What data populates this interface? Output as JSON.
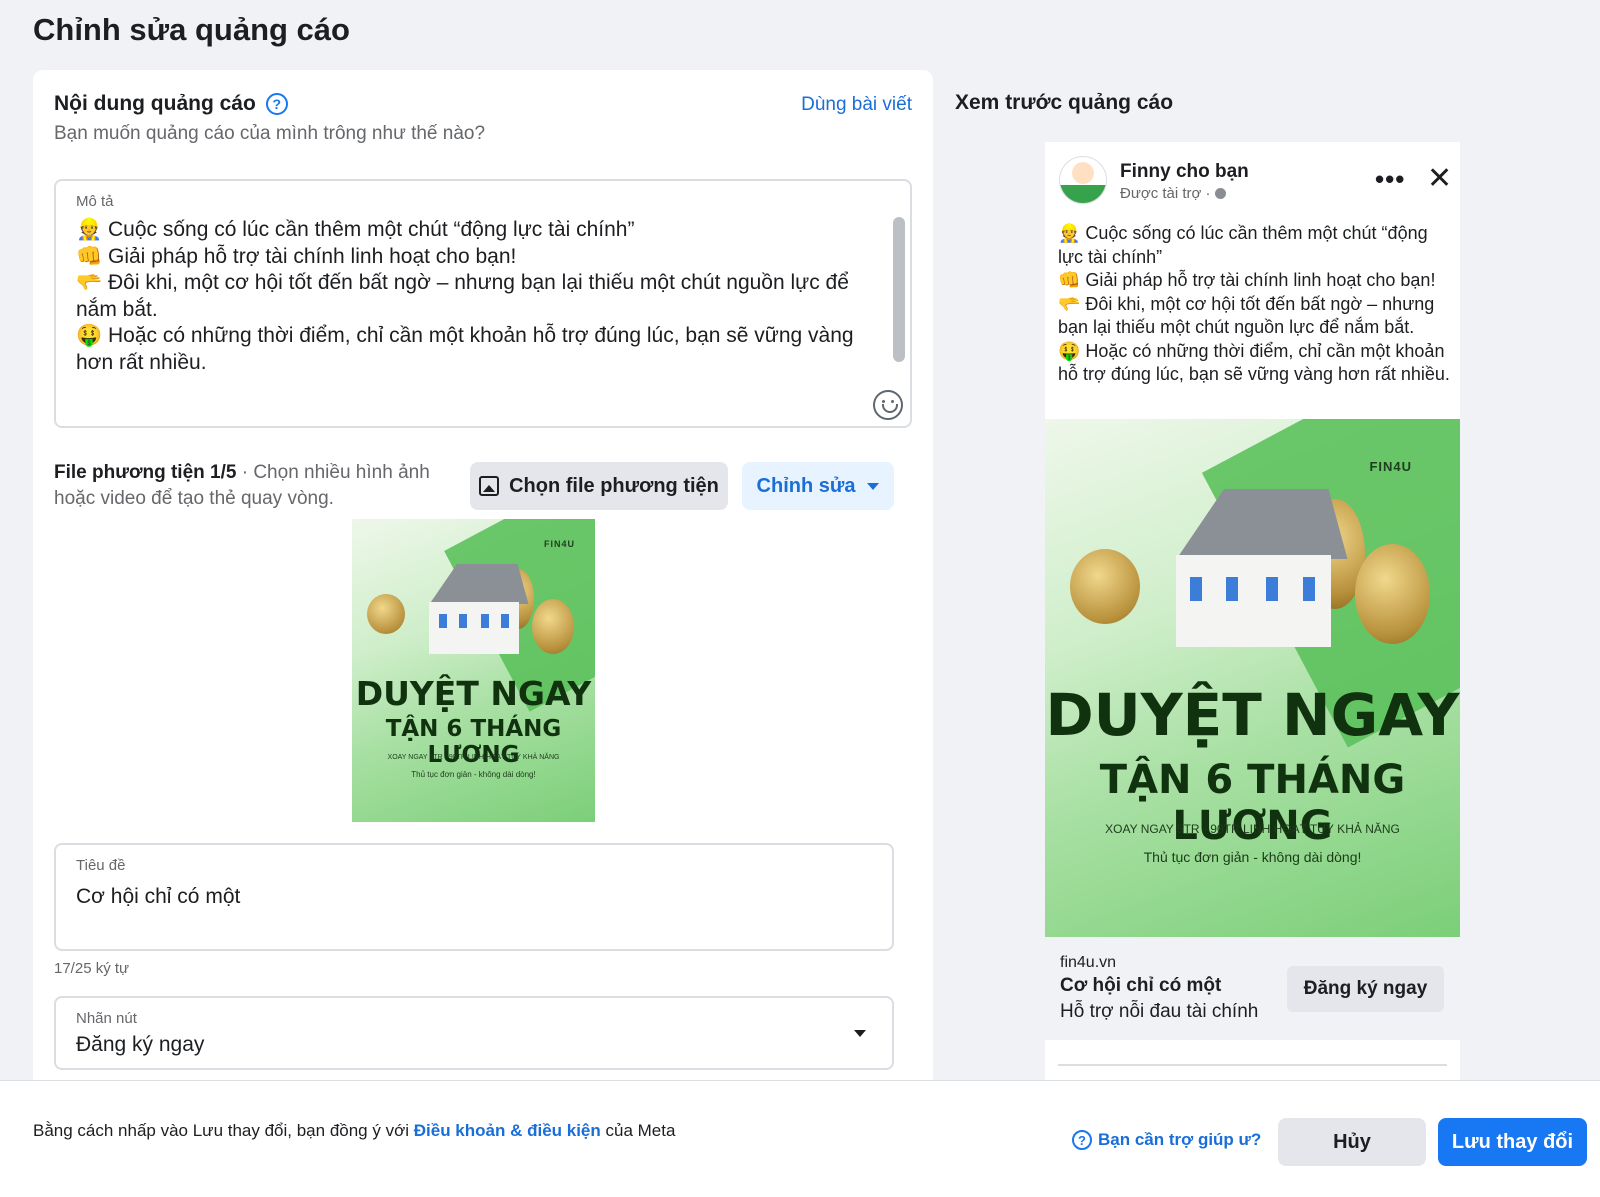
{
  "page": {
    "title": "Chỉnh sửa quảng cáo"
  },
  "content": {
    "section_title": "Nội dung quảng cáo",
    "use_post_link": "Dùng bài viết",
    "subtitle": "Bạn muốn quảng cáo của mình trông như thế nào?",
    "description_label": "Mô tả",
    "description_lines": [
      "👷 Cuộc sống có lúc cần thêm một chút “động lực tài chính”",
      "👊 Giải pháp hỗ trợ tài chính linh hoạt cho bạn!",
      "🫳 Đôi khi, một cơ hội tốt đến bất ngờ – nhưng bạn lại thiếu một chút nguồn lực để nắm bắt.",
      "🤑 Hoặc có những thời điểm, chỉ cần một khoản hỗ trợ đúng lúc, bạn sẽ vững vàng hơn rất nhiều."
    ],
    "media_title": "File phương tiện 1/5",
    "media_hint": "· Chọn nhiều hình ảnh hoặc video để tạo thẻ quay vòng.",
    "choose_media_button": "Chọn file phương tiện",
    "edit_button": "Chỉnh sửa",
    "headline_label": "Tiêu đề",
    "headline_value": "Cơ hội chỉ có một",
    "char_count": "17/25 ký tự",
    "cta_label": "Nhãn nút",
    "cta_value": "Đăng ký ngay"
  },
  "ad_creative": {
    "brand": "FIN4U",
    "headline_1": "DUYỆT NGAY",
    "headline_2": "TẬN 6 THÁNG LƯƠNG",
    "line_1": "XOAY NGAY 5TR - 90TR LINH HOẠT TUỲ KHẢ NĂNG",
    "line_2": "Thủ tục đơn giản - không dài dòng!"
  },
  "preview": {
    "title": "Xem trước quảng cáo",
    "page_name": "Finny cho bạn",
    "sponsored": "Được tài trợ ·",
    "more_icon": "•••",
    "close_icon": "✕",
    "text_lines": [
      "👷 Cuộc sống có lúc cần thêm một chút “động lực tài chính”",
      "👊 Giải pháp hỗ trợ tài chính linh hoạt cho bạn!",
      "🫳 Đôi khi, một cơ hội tốt đến bất ngờ – nhưng bạn lại thiếu một chút nguồn lực để nắm bắt.",
      "🤑 Hoặc có những thời điểm, chỉ cần một khoản hỗ trợ đúng lúc, bạn sẽ vững vàng hơn rất nhiều."
    ],
    "domain": "fin4u.vn",
    "headline": "Cơ hội chỉ có một",
    "description": "Hỗ trợ nỗi đau tài chính",
    "cta": "Đăng ký ngay"
  },
  "footer": {
    "terms_prefix": "Bằng cách nhấp vào Lưu thay đổi, bạn đồng ý với ",
    "terms_link": "Điều khoản & điều kiện",
    "terms_suffix": " của Meta",
    "help_link": "Bạn cần trợ giúp ư?",
    "cancel_button": "Hủy",
    "save_button": "Lưu thay đổi"
  },
  "colors": {
    "accent": "#1877f2",
    "link": "#1a6ed8",
    "background": "#f0f2f5"
  }
}
